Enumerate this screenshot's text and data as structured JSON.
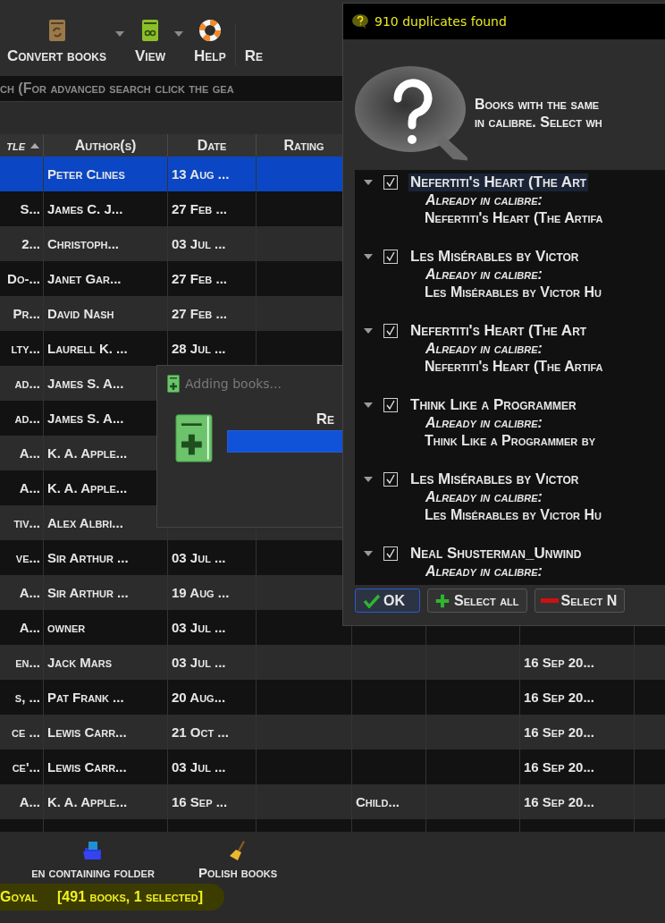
{
  "toolbar": {
    "items": [
      {
        "label": "Convert books",
        "kind": "convert",
        "dropdown": true
      },
      {
        "label": "View",
        "kind": "view",
        "dropdown": true
      },
      {
        "label": "Help",
        "kind": "help",
        "dropdown": false
      },
      {
        "label": "Re",
        "kind": "none",
        "dropdown": false
      }
    ]
  },
  "search": {
    "placeholder": "ch (For advanced search click the gea"
  },
  "table": {
    "columns": [
      {
        "label": "tle",
        "sorted": true
      },
      {
        "label": "Author(s)",
        "sorted": false
      },
      {
        "label": "Date",
        "sorted": false
      },
      {
        "label": "Rating",
        "sorted": false
      }
    ],
    "rows": [
      {
        "author": "Peter Clines",
        "date": "13 Aug ...",
        "selected": true
      },
      {
        "title": "S...",
        "author": "James C. J...",
        "date": "27 Feb ...",
        "selected": false
      },
      {
        "title": "2...",
        "author": "Christoph...",
        "date": "03 Jul ...",
        "selected": false
      },
      {
        "title": "Do-...",
        "author": "Janet Gar...",
        "date": "27 Feb ...",
        "selected": false
      },
      {
        "title": "Pr...",
        "author": "David Nash",
        "date": "27 Feb ...",
        "selected": false
      },
      {
        "title": "lty...",
        "author": "Laurell K. ...",
        "date": "28 Jul ...",
        "selected": false
      },
      {
        "title": "ad...",
        "author": "James S. A...",
        "selected": false
      },
      {
        "title": "ad...",
        "author": "James S. A...",
        "selected": false
      },
      {
        "title": "A...",
        "author": "K. A. Apple...",
        "selected": false
      },
      {
        "title": "A...",
        "author": "K. A. Apple...",
        "selected": false
      },
      {
        "title": "tiv...",
        "author": "Alex Albri...",
        "selected": false
      },
      {
        "title": "ve...",
        "author": "Sir Arthur ...",
        "date": "03 Jul ...",
        "selected": false
      },
      {
        "title": "A...",
        "author": "Sir Arthur ...",
        "date": "19 Aug ...",
        "selected": false
      },
      {
        "title": "A...",
        "author": "owner",
        "date": "03 Jul ...",
        "selected": false
      },
      {
        "title": "en...",
        "author": "Jack Mars",
        "date": "03 Jul ...",
        "column_7": "16 Sep 20...",
        "selected": false
      },
      {
        "title": "s, ...",
        "author": "Pat Frank ...",
        "date": "20 Aug...",
        "column_7": "16 Sep 20...",
        "selected": false
      },
      {
        "title": "ce ...",
        "author": "Lewis Carr...",
        "date": "21 Oct ...",
        "column_7": "16 Sep 20...",
        "selected": false
      },
      {
        "title": "ce'...",
        "author": "Lewis Carr...",
        "date": "03 Jul ...",
        "column_7": "16 Sep 20...",
        "selected": false
      },
      {
        "title": "A...",
        "author": "K. A. Apple...",
        "date": "16 Sep ...",
        "column_5": "Child...",
        "column_7": "16 Sep 20...",
        "selected": false
      }
    ]
  },
  "bottom_toolbar": {
    "items": [
      {
        "label": "en containing folder",
        "kind": "folder"
      },
      {
        "label": "Polish books",
        "kind": "polish"
      }
    ]
  },
  "status_bar": {
    "user": "Goyal",
    "count": "[491 books, 1 selected]"
  },
  "adding_dialog": {
    "title": "Adding books...",
    "label": "Re",
    "level": 1
  },
  "duplicates_dialog": {
    "title": "910 duplicates found",
    "message": [
      "Books with the same",
      "in calibre. Select wh"
    ],
    "items": [
      {
        "title": "Nefertiti's Heart (The Art",
        "note": "Already in calibre:",
        "existing": "Nefertiti's Heart (The Artifa",
        "checked": true,
        "expanded": true,
        "selected": true
      },
      {
        "title": "Les Misérables by Victor",
        "note": "Already in calibre:",
        "existing": "Les Misérables by Victor Hu",
        "checked": true,
        "expanded": true,
        "selected": false
      },
      {
        "title": "Nefertiti's Heart (The Art",
        "note": "Already in calibre:",
        "existing": "Nefertiti's Heart (The Artifa",
        "checked": true,
        "expanded": true,
        "selected": false
      },
      {
        "title": "Think Like a Programmer",
        "note": "Already in calibre:",
        "existing": "Think Like a Programmer by",
        "checked": true,
        "expanded": true,
        "selected": false
      },
      {
        "title": "Les Misérables by Victor",
        "note": "Already in calibre:",
        "existing": "Les Misérables by Victor Hu",
        "checked": true,
        "expanded": true,
        "selected": false
      },
      {
        "title": "Neal Shusterman_Unwind",
        "note": "Already in calibre:",
        "checked": true,
        "expanded": true,
        "selected": false
      }
    ],
    "buttons": [
      {
        "label": "OK",
        "kind": "ok",
        "focused": true
      },
      {
        "label": "Select all",
        "kind": "add",
        "focused": false
      },
      {
        "label": "Select N",
        "kind": "remove",
        "focused": false
      }
    ]
  }
}
